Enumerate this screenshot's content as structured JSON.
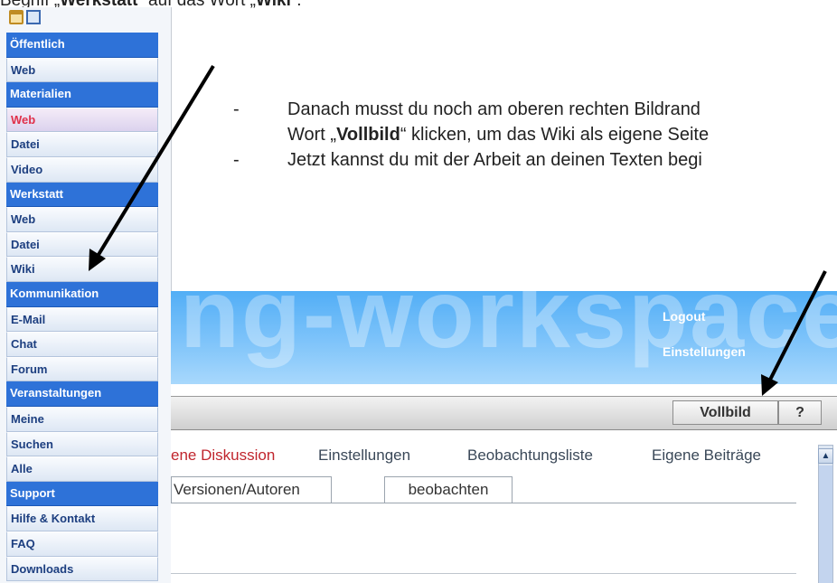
{
  "doc": {
    "top_line_prefix": "Begriff „",
    "top_line_bold1": "Werkstatt",
    "top_line_mid": "“ auf das Wort „",
    "top_line_bold2": "Wiki",
    "top_line_suffix": "“.",
    "bullets": [
      {
        "dash": "-",
        "text": "Danach musst du noch am oberen rechten Bildrand"
      },
      {
        "dash": "-",
        "text": "Jetzt kannst du mit der Arbeit an deinen Texten begi"
      }
    ],
    "sub_line_prefix": "Wort „",
    "sub_line_bold": "Vollbild",
    "sub_line_suffix": "“ klicken, um das Wiki als eigene Seite"
  },
  "sidebar": {
    "items": [
      {
        "label": "Öffentlich",
        "kind": "header"
      },
      {
        "label": "Web",
        "kind": "item"
      },
      {
        "label": "Materialien",
        "kind": "header"
      },
      {
        "label": "Web",
        "kind": "item",
        "active": true
      },
      {
        "label": "Datei",
        "kind": "item"
      },
      {
        "label": "Video",
        "kind": "item"
      },
      {
        "label": "Werkstatt",
        "kind": "header"
      },
      {
        "label": "Web",
        "kind": "item"
      },
      {
        "label": "Datei",
        "kind": "item"
      },
      {
        "label": "Wiki",
        "kind": "item"
      },
      {
        "label": "Kommunikation",
        "kind": "header"
      },
      {
        "label": "E-Mail",
        "kind": "item"
      },
      {
        "label": "Chat",
        "kind": "item"
      },
      {
        "label": "Forum",
        "kind": "item"
      },
      {
        "label": "Veranstaltungen",
        "kind": "header"
      },
      {
        "label": "Meine",
        "kind": "item"
      },
      {
        "label": "Suchen",
        "kind": "item"
      },
      {
        "label": "Alle",
        "kind": "item"
      },
      {
        "label": "Support",
        "kind": "header"
      },
      {
        "label": "Hilfe & Kontakt",
        "kind": "item"
      },
      {
        "label": "FAQ",
        "kind": "item"
      },
      {
        "label": "Downloads",
        "kind": "item"
      }
    ]
  },
  "screenshot": {
    "banner_text": "ng-workspace",
    "logout": "Logout",
    "settings": "Einstellungen",
    "vollbild": "Vollbild",
    "help": "?",
    "nav": [
      {
        "label": "ene Diskussion",
        "color": "#c0252d"
      },
      {
        "label": "Einstellungen",
        "color": "#3a4858"
      },
      {
        "label": "Beobachtungsliste",
        "color": "#3a4858"
      },
      {
        "label": "Eigene Beiträge",
        "color": "#3a4858"
      }
    ],
    "tabs": [
      "Versionen/Autoren",
      "beobachten"
    ]
  },
  "colors": {
    "sidebar_header": "#2e72d8",
    "active_item": "#e0304a",
    "arrow": "#000000"
  }
}
